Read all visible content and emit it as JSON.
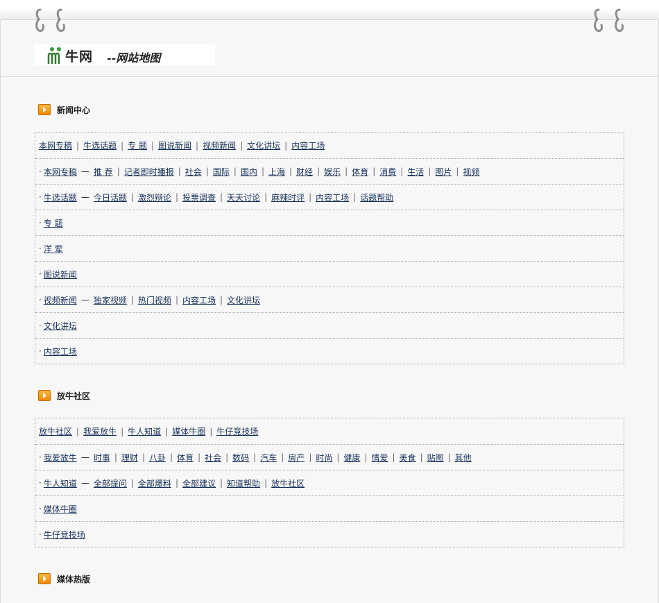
{
  "header": {
    "logo_name": "牛网",
    "logo_subtitle": "--网站地图"
  },
  "sections": [
    {
      "title": "新闻中心",
      "rows": [
        {
          "bullet": false,
          "parts": [
            {
              "t": "link",
              "v": "本网专稿"
            },
            {
              "t": "sep",
              "v": "|"
            },
            {
              "t": "link",
              "v": "牛选话题"
            },
            {
              "t": "sep",
              "v": "|"
            },
            {
              "t": "link",
              "v": "专  题"
            },
            {
              "t": "sep",
              "v": "|"
            },
            {
              "t": "link",
              "v": "图说新闻"
            },
            {
              "t": "sep",
              "v": "|"
            },
            {
              "t": "link",
              "v": "视频新闻"
            },
            {
              "t": "sep",
              "v": "|"
            },
            {
              "t": "link",
              "v": "文化讲坛"
            },
            {
              "t": "sep",
              "v": "|"
            },
            {
              "t": "link",
              "v": "内容工场"
            }
          ]
        },
        {
          "bullet": true,
          "parts": [
            {
              "t": "link",
              "v": "本网专稿"
            },
            {
              "t": "dash",
              "v": "一"
            },
            {
              "t": "link",
              "v": "推  荐"
            },
            {
              "t": "sep",
              "v": "|"
            },
            {
              "t": "link",
              "v": "记者即时播报"
            },
            {
              "t": "sep",
              "v": "|"
            },
            {
              "t": "link",
              "v": "社会"
            },
            {
              "t": "sep",
              "v": "|"
            },
            {
              "t": "link",
              "v": "国际"
            },
            {
              "t": "sep",
              "v": "|"
            },
            {
              "t": "link",
              "v": "国内"
            },
            {
              "t": "sep",
              "v": "|"
            },
            {
              "t": "link",
              "v": "上海"
            },
            {
              "t": "sep",
              "v": "|"
            },
            {
              "t": "link",
              "v": "财经"
            },
            {
              "t": "sep",
              "v": "|"
            },
            {
              "t": "link",
              "v": "娱乐"
            },
            {
              "t": "sep",
              "v": "|"
            },
            {
              "t": "link",
              "v": "体育"
            },
            {
              "t": "sep",
              "v": "|"
            },
            {
              "t": "link",
              "v": "消费"
            },
            {
              "t": "sep",
              "v": "|"
            },
            {
              "t": "link",
              "v": "生活"
            },
            {
              "t": "sep",
              "v": "|"
            },
            {
              "t": "link",
              "v": "图片"
            },
            {
              "t": "sep",
              "v": "|"
            },
            {
              "t": "link",
              "v": "视频"
            }
          ]
        },
        {
          "bullet": true,
          "parts": [
            {
              "t": "link",
              "v": "牛选话题"
            },
            {
              "t": "dash",
              "v": "一"
            },
            {
              "t": "link",
              "v": "今日话题"
            },
            {
              "t": "sep",
              "v": "|"
            },
            {
              "t": "link",
              "v": "激烈辩论"
            },
            {
              "t": "sep",
              "v": "|"
            },
            {
              "t": "link",
              "v": "投票调查"
            },
            {
              "t": "sep",
              "v": "|"
            },
            {
              "t": "link",
              "v": "天天讨论"
            },
            {
              "t": "sep",
              "v": "|"
            },
            {
              "t": "link",
              "v": "麻辣时评"
            },
            {
              "t": "sep",
              "v": "|"
            },
            {
              "t": "link",
              "v": "内容工场"
            },
            {
              "t": "sep",
              "v": "|"
            },
            {
              "t": "link",
              "v": "话题帮助"
            }
          ]
        },
        {
          "bullet": true,
          "parts": [
            {
              "t": "link",
              "v": "专  题"
            }
          ]
        },
        {
          "bullet": true,
          "parts": [
            {
              "t": "link",
              "v": "洋  荤"
            }
          ]
        },
        {
          "bullet": true,
          "parts": [
            {
              "t": "link",
              "v": "图说新闻"
            }
          ]
        },
        {
          "bullet": true,
          "parts": [
            {
              "t": "link",
              "v": "视频新闻"
            },
            {
              "t": "dash",
              "v": "一"
            },
            {
              "t": "link",
              "v": "独家视频"
            },
            {
              "t": "sep",
              "v": "|"
            },
            {
              "t": "link",
              "v": "热门视频"
            },
            {
              "t": "sep",
              "v": "|"
            },
            {
              "t": "link",
              "v": "内容工场"
            },
            {
              "t": "sep",
              "v": "|"
            },
            {
              "t": "link",
              "v": "文化讲坛"
            }
          ]
        },
        {
          "bullet": true,
          "parts": [
            {
              "t": "link",
              "v": "文化讲坛"
            }
          ]
        },
        {
          "bullet": true,
          "parts": [
            {
              "t": "link",
              "v": "内容工场"
            }
          ]
        }
      ]
    },
    {
      "title": "放牛社区",
      "rows": [
        {
          "bullet": false,
          "parts": [
            {
              "t": "link",
              "v": "放牛社区"
            },
            {
              "t": "sep",
              "v": "|"
            },
            {
              "t": "link",
              "v": "我爱放牛"
            },
            {
              "t": "sep",
              "v": "|"
            },
            {
              "t": "link",
              "v": "牛人知道"
            },
            {
              "t": "sep",
              "v": "|"
            },
            {
              "t": "link",
              "v": "媒体牛圈"
            },
            {
              "t": "sep",
              "v": "|"
            },
            {
              "t": "link",
              "v": "牛仔竞技场"
            }
          ]
        },
        {
          "bullet": true,
          "parts": [
            {
              "t": "link",
              "v": "我爱放牛"
            },
            {
              "t": "dash",
              "v": "一"
            },
            {
              "t": "link",
              "v": "时事"
            },
            {
              "t": "sep",
              "v": "|"
            },
            {
              "t": "link",
              "v": "理财"
            },
            {
              "t": "sep",
              "v": "|"
            },
            {
              "t": "link",
              "v": "八卦"
            },
            {
              "t": "sep",
              "v": "|"
            },
            {
              "t": "link",
              "v": "体育"
            },
            {
              "t": "sep",
              "v": "|"
            },
            {
              "t": "link",
              "v": "社会"
            },
            {
              "t": "sep",
              "v": "|"
            },
            {
              "t": "link",
              "v": "数码"
            },
            {
              "t": "sep",
              "v": "|"
            },
            {
              "t": "link",
              "v": "汽车"
            },
            {
              "t": "sep",
              "v": "|"
            },
            {
              "t": "link",
              "v": "房产"
            },
            {
              "t": "sep",
              "v": "|"
            },
            {
              "t": "link",
              "v": "时尚"
            },
            {
              "t": "sep",
              "v": "|"
            },
            {
              "t": "link",
              "v": "健康"
            },
            {
              "t": "sep",
              "v": "|"
            },
            {
              "t": "link",
              "v": "情爱"
            },
            {
              "t": "sep",
              "v": "|"
            },
            {
              "t": "link",
              "v": "美食"
            },
            {
              "t": "sep",
              "v": "|"
            },
            {
              "t": "link",
              "v": "贴图"
            },
            {
              "t": "sep",
              "v": "|"
            },
            {
              "t": "link",
              "v": "其他"
            }
          ]
        },
        {
          "bullet": true,
          "parts": [
            {
              "t": "link",
              "v": "牛人知道"
            },
            {
              "t": "dash",
              "v": "一"
            },
            {
              "t": "link",
              "v": "全部提问"
            },
            {
              "t": "sep",
              "v": "|"
            },
            {
              "t": "link",
              "v": "全部爆料"
            },
            {
              "t": "sep",
              "v": "|"
            },
            {
              "t": "link",
              "v": "全部建议"
            },
            {
              "t": "sep",
              "v": "|"
            },
            {
              "t": "link",
              "v": "知道帮助"
            },
            {
              "t": "sep",
              "v": "|"
            },
            {
              "t": "link",
              "v": "放牛社区"
            }
          ]
        },
        {
          "bullet": true,
          "parts": [
            {
              "t": "link",
              "v": "媒体牛圈"
            }
          ]
        },
        {
          "bullet": true,
          "parts": [
            {
              "t": "link",
              "v": "牛仔竞技场"
            }
          ]
        }
      ]
    },
    {
      "title": "媒体热版",
      "rows": []
    }
  ]
}
